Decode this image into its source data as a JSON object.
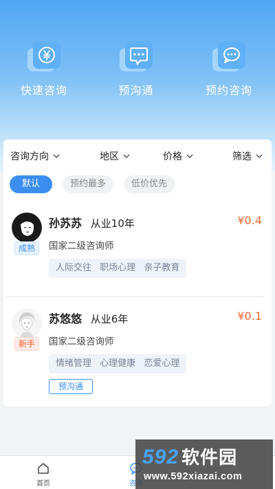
{
  "quick_actions": [
    {
      "label": "快速咨询",
      "icon": "yen-exchange-icon"
    },
    {
      "label": "预沟通",
      "icon": "chat-bubble-dots-icon"
    },
    {
      "label": "预约咨询",
      "icon": "speech-bubble-icon"
    }
  ],
  "filters": [
    {
      "label": "咨询方向"
    },
    {
      "label": "地区"
    },
    {
      "label": "价格"
    },
    {
      "label": "筛选"
    }
  ],
  "sort_options": [
    {
      "label": "默认",
      "active": true
    },
    {
      "label": "预约最多",
      "active": false
    },
    {
      "label": "低价优先",
      "active": false
    }
  ],
  "counselors": [
    {
      "name": "孙苏苏",
      "experience": "从业10年",
      "price": "¥0.4",
      "title": "国家二级咨询师",
      "tags": [
        "人际交往",
        "职场心理",
        "亲子教育"
      ],
      "level": "成熟",
      "level_color": "#3b8ef0"
    },
    {
      "name": "苏悠悠",
      "experience": "从业6年",
      "price": "¥0.1",
      "title": "国家二级咨询师",
      "tags": [
        "情绪管理",
        "心理健康",
        "恋爱心理"
      ],
      "level": "新手",
      "level_color": "#f0602c",
      "extra_chip": "预沟通"
    }
  ],
  "tabbar": {
    "home": "首页",
    "consult": "咨询"
  },
  "watermark": {
    "brand_digits": "592",
    "brand_text": "软件园",
    "url": "www.592xiazai.com"
  },
  "colors": {
    "accent": "#3b8ef0",
    "price": "#f06a35"
  }
}
